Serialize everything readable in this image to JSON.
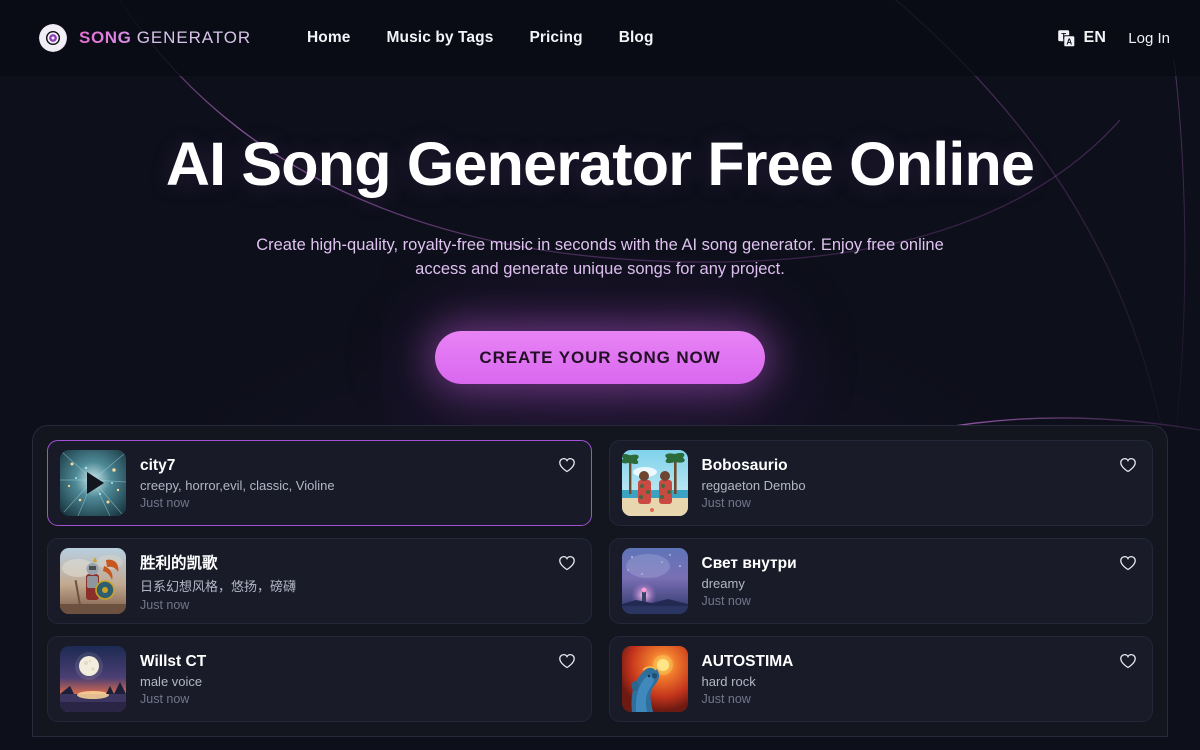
{
  "header": {
    "brand": {
      "logo_icon": "vinyl-disc-icon",
      "word_primary": "SONG",
      "word_secondary": "GENERATOR",
      "primary_color": "#e36fd0",
      "secondary_color": "#d7c4e8"
    },
    "nav": [
      {
        "label": "Home"
      },
      {
        "label": "Music by Tags"
      },
      {
        "label": "Pricing"
      },
      {
        "label": "Blog"
      }
    ],
    "language": {
      "icon": "translate-icon",
      "code": "EN"
    },
    "login_label": "Log In"
  },
  "hero": {
    "title": "AI Song Generator Free Online",
    "subtitle": "Create high-quality, royalty-free music in seconds with the AI song generator. Enjoy free online access and generate unique songs for any project.",
    "cta_label": "CREATE YOUR SONG NOW",
    "cta_color": "#d968ef",
    "subtitle_color": "#dfc3f0"
  },
  "songs": {
    "active_index": 0,
    "items": [
      {
        "title": "city7",
        "tags": "creepy, horror,evil, classic, Violine",
        "time": "Just now",
        "thumb": "starburst-lights",
        "playing": true,
        "favorite": false
      },
      {
        "title": "Bobosaurio",
        "tags": "reggaeton Dembo",
        "time": "Just now",
        "thumb": "beach-palms",
        "playing": false,
        "favorite": false
      },
      {
        "title": "胜利的凯歌",
        "tags": "日系幻想风格，悠扬，磅礴",
        "time": "Just now",
        "thumb": "knight-warrior",
        "playing": false,
        "favorite": false
      },
      {
        "title": "Свет внутри",
        "tags": "dreamy",
        "time": "Just now",
        "thumb": "lighthouse-night",
        "playing": false,
        "favorite": false
      },
      {
        "title": "Willst CT",
        "tags": "male voice",
        "time": "Just now",
        "thumb": "moon-sunset",
        "playing": false,
        "favorite": false
      },
      {
        "title": "AUTOSTIMA",
        "tags": "hard rock",
        "time": "Just now",
        "thumb": "blue-face-sun",
        "playing": false,
        "favorite": false
      }
    ]
  },
  "theme": {
    "background": "#0d0f1a",
    "header_background": "#080a14",
    "panel_background": "#13151f",
    "card_background": "#191c28",
    "accent": "#a34fd6",
    "arc_color": "#8e4f9e"
  }
}
